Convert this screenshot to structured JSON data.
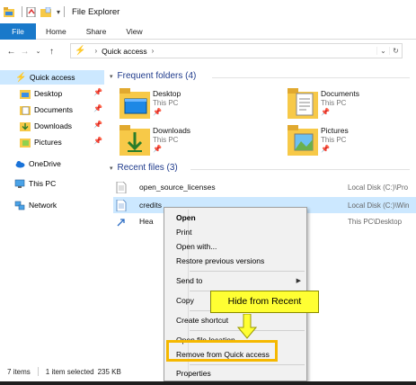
{
  "window": {
    "title": "File Explorer"
  },
  "ribbon": {
    "tabs": [
      "File",
      "Home",
      "Share",
      "View"
    ]
  },
  "nav": {
    "breadcrumb": [
      "Quick access"
    ]
  },
  "sidebar": {
    "items": [
      {
        "label": "Quick access",
        "icon": "lightning-icon"
      },
      {
        "label": "Desktop",
        "icon": "folder-icon",
        "pinned": true
      },
      {
        "label": "Documents",
        "icon": "documents-folder-icon",
        "pinned": true
      },
      {
        "label": "Downloads",
        "icon": "downloads-folder-icon",
        "pinned": true
      },
      {
        "label": "Pictures",
        "icon": "pictures-folder-icon",
        "pinned": true
      },
      {
        "label": "OneDrive",
        "icon": "cloud-icon"
      },
      {
        "label": "This PC",
        "icon": "computer-icon"
      },
      {
        "label": "Network",
        "icon": "network-icon"
      }
    ]
  },
  "frequent": {
    "title": "Frequent folders (4)",
    "folders": [
      {
        "name": "Desktop",
        "location": "This PC"
      },
      {
        "name": "Documents",
        "location": "This PC"
      },
      {
        "name": "Downloads",
        "location": "This PC"
      },
      {
        "name": "Pictures",
        "location": "This PC"
      }
    ]
  },
  "recent": {
    "title": "Recent files (3)",
    "files": [
      {
        "name": "open_source_licenses",
        "location": "Local Disk (C:)\\Pro"
      },
      {
        "name": "credits",
        "location": "Local Disk (C:)\\Win"
      },
      {
        "name": "Hea",
        "location": "This PC\\Desktop"
      }
    ]
  },
  "context_menu": {
    "items": [
      "Open",
      "Print",
      "Open with...",
      "Restore previous versions",
      "Send to",
      "Copy",
      "Create shortcut",
      "Open file location",
      "Remove from Quick access",
      "Properties"
    ]
  },
  "callout": {
    "text": "Hide from Recent"
  },
  "status": {
    "items": "7 items",
    "selected": "1 item selected",
    "size": "235 KB"
  },
  "colors": {
    "accent": "#1979ca",
    "selection": "#cce8ff",
    "callout": "#ffff33",
    "highlight": "#f5b800",
    "folder": "#f7c948"
  }
}
